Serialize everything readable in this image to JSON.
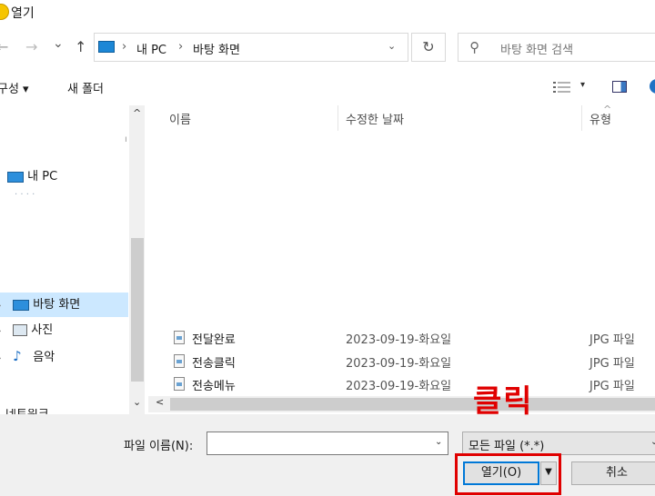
{
  "window": {
    "title": "열기"
  },
  "nav": {
    "back": "←",
    "forward": "→",
    "recent": "⌄",
    "up": "↑",
    "breadcrumb": [
      "내 PC",
      "바탕 화면"
    ],
    "crumb_sep": "›",
    "addr_drop": "⌄",
    "refresh": "↻",
    "search_placeholder": "바탕 화면 검색"
  },
  "toolbar": {
    "organize": "구성 ▾",
    "new_folder": "새 폴더",
    "view_drop": "▾"
  },
  "tree": {
    "items": [
      {
        "label": "내 PC"
      },
      {
        "label": "바탕 화면",
        "selected": true
      },
      {
        "label": "사진"
      },
      {
        "label": "음악"
      }
    ],
    "chevron": "›",
    "partial_1": "· · · ·",
    "partial_2": "네트워크"
  },
  "list": {
    "columns": [
      "이름",
      "수정한 날짜",
      "유형"
    ],
    "sort_arrow": "^",
    "rows": [
      {
        "name": "전달완료",
        "date": "2023-09-19-화요일",
        "type": "JPG 파일"
      },
      {
        "name": "전송클릭",
        "date": "2023-09-19-화요일",
        "type": "JPG 파일"
      },
      {
        "name": "전송메뉴",
        "date": "2023-09-19-화요일",
        "type": "JPG 파일"
      }
    ]
  },
  "scroll": {
    "up": "^",
    "down": "⌄",
    "left": "<"
  },
  "bottom": {
    "filename_label": "파일 이름(N):",
    "filename_value": "",
    "dropdown": "⌄",
    "filter": "모든 파일 (*.*)",
    "open": "열기(O)",
    "split": "▼",
    "cancel": "취소"
  },
  "annotation": {
    "text": "클릭",
    "color": "#e00000"
  },
  "colors": {
    "accent": "#0078d7",
    "selection": "#cce8ff"
  }
}
